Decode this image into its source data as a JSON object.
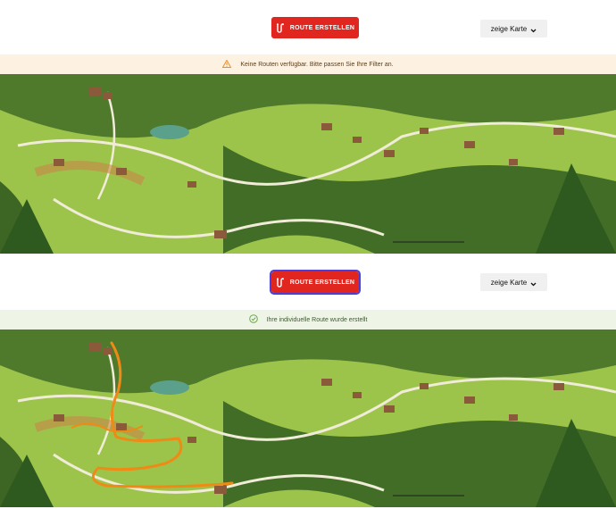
{
  "top_state": {
    "route_button_label": "ROUTE ERSTELLEN",
    "map_toggle_label": "zeige Karte",
    "banner_text": "Keine Routen verfügbar. Bitte passen Sie Ihre Filter an.",
    "banner_icon": "warning-triangle-icon"
  },
  "bottom_state": {
    "route_button_label": "ROUTE ERSTELLEN",
    "map_toggle_label": "zeige Karte",
    "banner_text": "Ihre individuelle Route wurde erstellt",
    "banner_icon": "check-circle-icon",
    "route_highlighted": true
  },
  "colors": {
    "accent_red": "#e0261f",
    "warning_orange": "#e8912b",
    "success_green": "#6aa84f",
    "route_orange": "#f08a16"
  }
}
